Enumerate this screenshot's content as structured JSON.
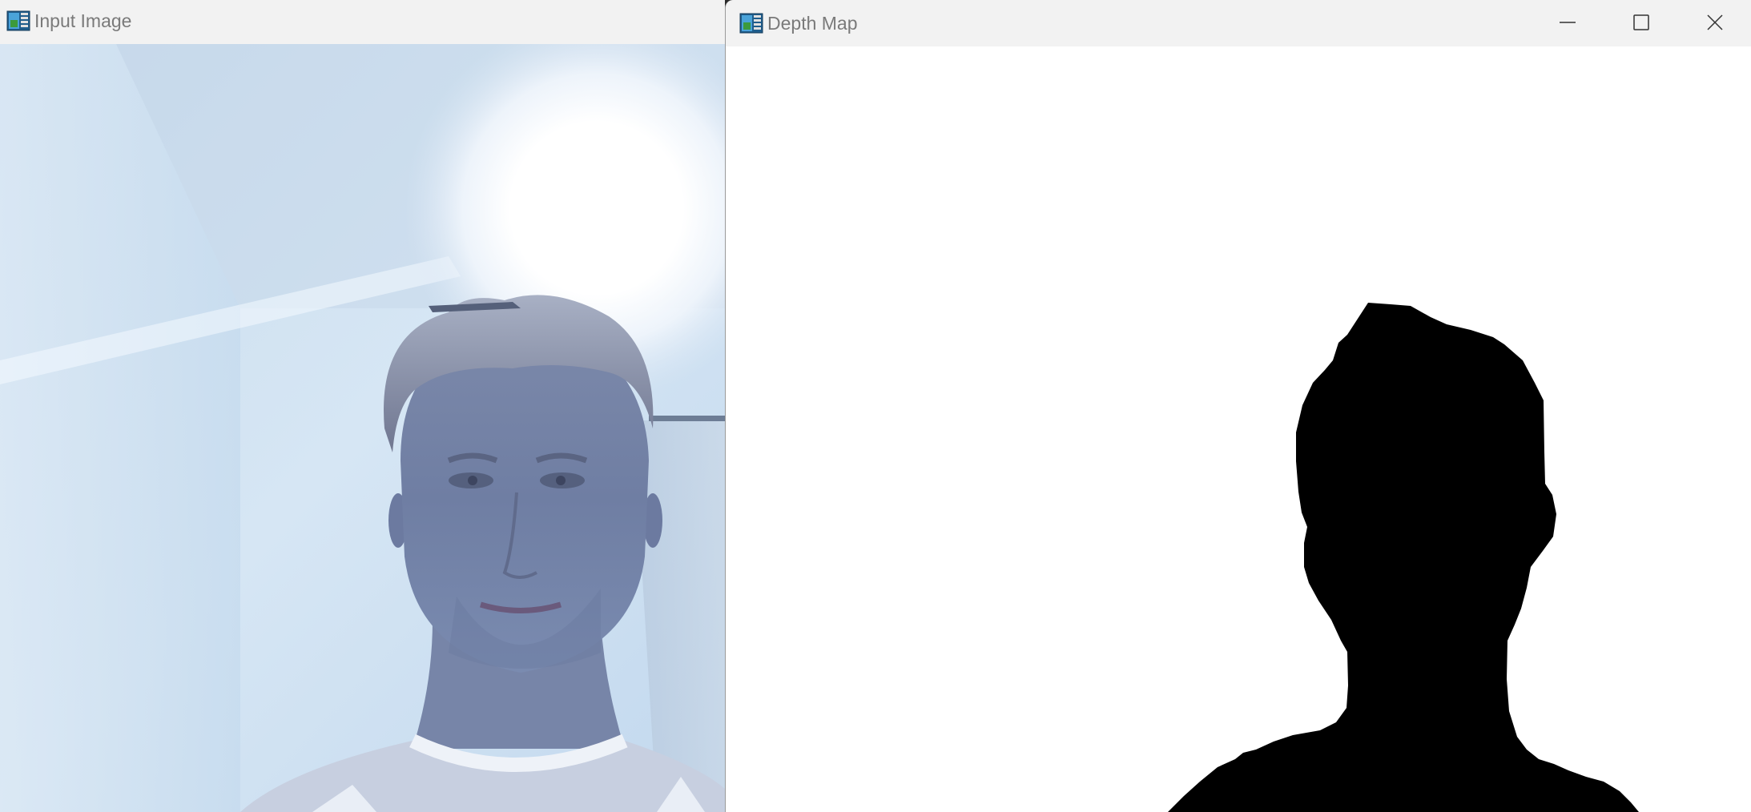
{
  "windows": {
    "input": {
      "title": "Input Image",
      "icon": "app-window-icon",
      "content": "webcam-frame"
    },
    "depth": {
      "title": "Depth Map",
      "icon": "app-window-icon",
      "content": "binary-silhouette-mask",
      "controls": {
        "minimize": "minimize-icon",
        "maximize": "maximize-icon",
        "close": "close-icon"
      }
    }
  },
  "colors": {
    "titlebar_bg": "#f2f2f2",
    "title_text": "#7a7a7a",
    "mask_foreground": "#000000",
    "mask_background": "#ffffff"
  }
}
